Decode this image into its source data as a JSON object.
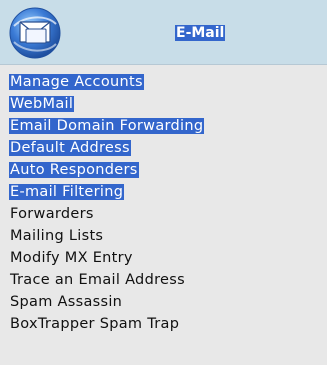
{
  "header": {
    "title": "E-Mail",
    "icon": "email-globe-icon"
  },
  "menu": {
    "items": [
      {
        "label": "Manage Accounts",
        "selected": true
      },
      {
        "label": "WebMail",
        "selected": true
      },
      {
        "label": "Email Domain Forwarding",
        "selected": true
      },
      {
        "label": "Default Address",
        "selected": true
      },
      {
        "label": "Auto Responders",
        "selected": true
      },
      {
        "label": "E-mail Filtering",
        "selected": true
      },
      {
        "label": "Forwarders",
        "selected": false
      },
      {
        "label": "Mailing Lists",
        "selected": false
      },
      {
        "label": "Modify MX Entry",
        "selected": false
      },
      {
        "label": "Trace an Email Address",
        "selected": false
      },
      {
        "label": "Spam Assassin",
        "selected": false
      },
      {
        "label": "BoxTrapper Spam Trap",
        "selected": false
      }
    ]
  },
  "colors": {
    "selection": "#3366cc",
    "header_bg": "#c8dde8",
    "panel_bg": "#e8e8e8"
  }
}
